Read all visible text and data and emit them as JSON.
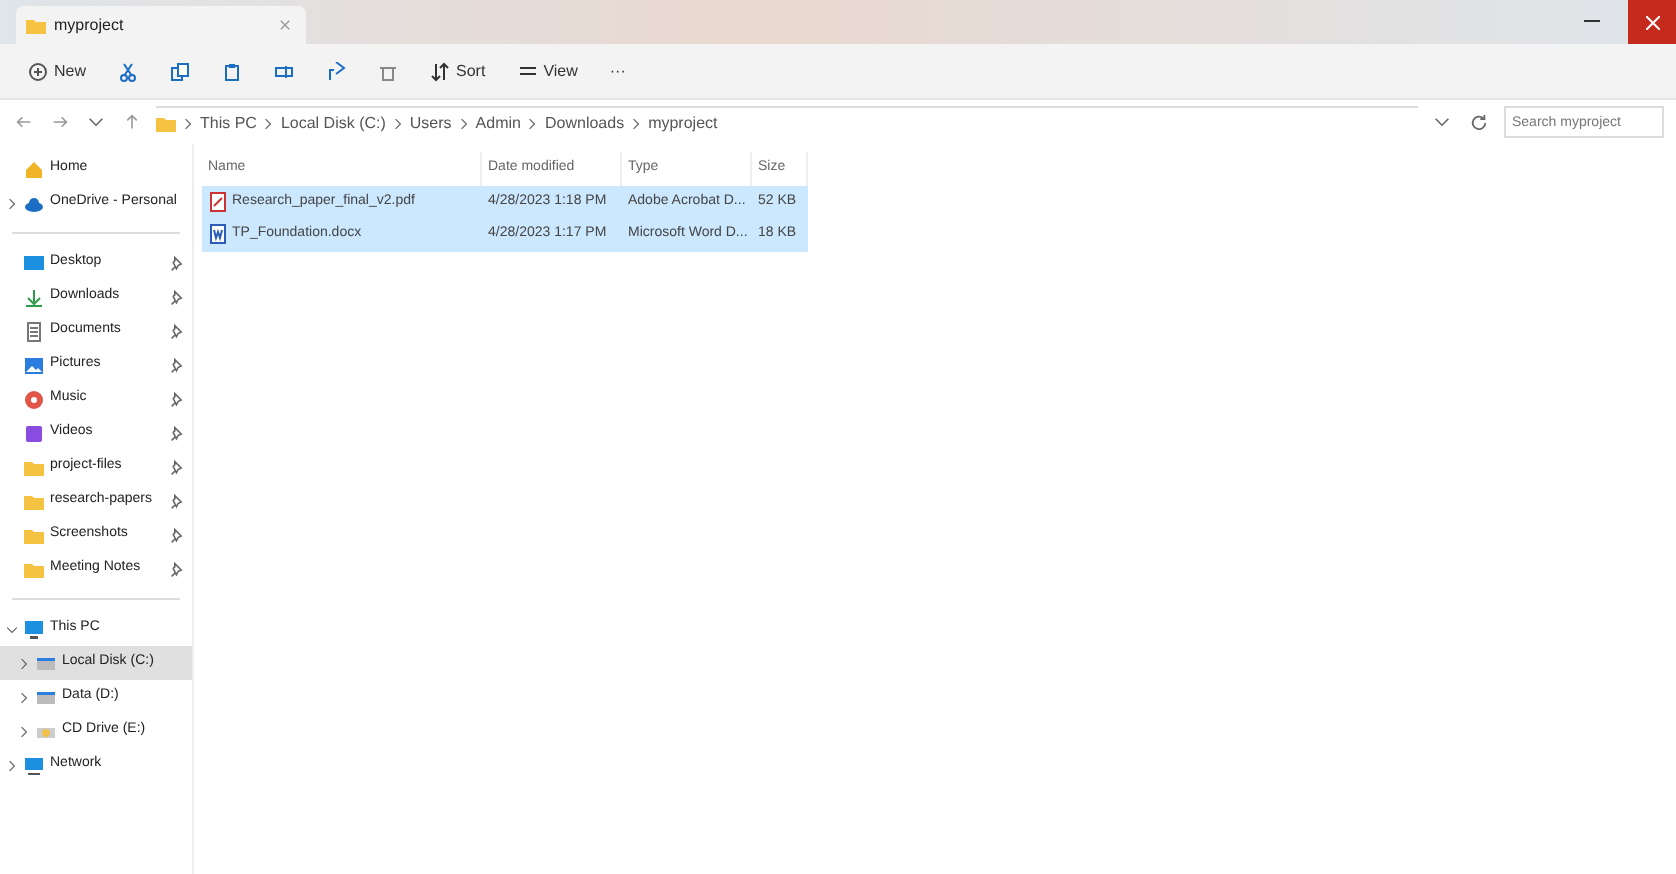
{
  "window": {
    "tab_title": "myproject"
  },
  "toolbar": [
    {
      "kind": "labeled",
      "label": "New"
    },
    {
      "kind": "icon"
    },
    {
      "kind": "icon"
    },
    {
      "kind": "icon"
    },
    {
      "kind": "icon"
    },
    {
      "kind": "icon"
    },
    {
      "kind": "icon"
    },
    {
      "kind": "labeled",
      "label": "Sort"
    },
    {
      "kind": "labeled",
      "label": "View"
    },
    {
      "kind": "more",
      "label": "···"
    }
  ],
  "address": {
    "crumbs": [
      "This PC",
      "Local Disk (C:)",
      "Users",
      "Admin",
      "Downloads",
      "myproject"
    ],
    "search_placeholder": "Search myproject"
  },
  "sidebar": [
    {
      "items": [
        {
          "kind": "plain",
          "label": "Home",
          "selected": false
        },
        {
          "kind": "expandable",
          "label": "OneDrive - Personal",
          "expanded": false,
          "selected": false
        }
      ]
    },
    {
      "items": [
        {
          "kind": "pinned",
          "label": "Desktop",
          "selected": false
        },
        {
          "kind": "pinned",
          "label": "Downloads",
          "selected": false
        },
        {
          "kind": "pinned",
          "label": "Documents",
          "selected": false
        },
        {
          "kind": "pinned",
          "label": "Pictures",
          "selected": false
        },
        {
          "kind": "pinned",
          "label": "Music",
          "selected": false
        },
        {
          "kind": "pinned",
          "label": "Videos",
          "selected": false
        },
        {
          "kind": "pinned",
          "label": "project-files",
          "selected": false
        },
        {
          "kind": "pinned",
          "label": "research-papers",
          "selected": false
        },
        {
          "kind": "pinned",
          "label": "Screenshots",
          "selected": false
        },
        {
          "kind": "pinned",
          "label": "Meeting Notes",
          "selected": false
        }
      ]
    },
    {
      "items": [
        {
          "kind": "expandable",
          "label": "This PC",
          "expanded": true,
          "selected": false,
          "children": [
            {
              "kind": "expandable",
              "label": "Local Disk (C:)",
              "expanded": false,
              "selected": true
            },
            {
              "kind": "expandable",
              "label": "Data (D:)",
              "expanded": false,
              "selected": false
            },
            {
              "kind": "expandable",
              "label": "CD Drive (E:)",
              "expanded": false,
              "selected": false
            }
          ]
        },
        {
          "kind": "expandable",
          "label": "Network",
          "expanded": false,
          "selected": false
        }
      ]
    }
  ],
  "table": {
    "columns": [
      "Name",
      "Date modified",
      "Type",
      "Size"
    ],
    "rows": [
      {
        "kind": "pdf",
        "name": "Research_paper_final_v2.pdf",
        "date": "4/28/2023 1:18 PM",
        "type": "Adobe Acrobat D...",
        "size": "52 KB",
        "selected": true
      },
      {
        "kind": "doc",
        "name": "TP_Foundation.docx",
        "date": "4/28/2023 1:17 PM",
        "type": "Microsoft Word D...",
        "size": "18 KB",
        "selected": true
      }
    ]
  }
}
